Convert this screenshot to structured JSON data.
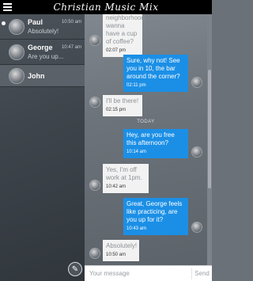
{
  "app": {
    "title": "Christian Music Mix"
  },
  "contacts": [
    {
      "name": "Paul",
      "preview": "Absolutely!",
      "time": "10:50 am",
      "online": true,
      "active": false
    },
    {
      "name": "George",
      "preview": "Are you up...",
      "time": "10:47 am",
      "online": false,
      "active": false
    },
    {
      "name": "John",
      "preview": "",
      "time": "",
      "online": false,
      "active": true
    }
  ],
  "conversation": {
    "today_label": "TODAY",
    "messages": [
      {
        "dir": "in",
        "text": "neighborhood, wanna have a cup of coffee?",
        "time": "02:07 pm"
      },
      {
        "dir": "out",
        "text": "Sure, why not! See you in 10, the bar around the corner?",
        "time": "02:11 pm"
      },
      {
        "dir": "in",
        "text": "I'll be there!",
        "time": "02:15 pm"
      },
      {
        "dir": "out",
        "text": "Hey, are you free this afternoon?",
        "time": "10:14 am"
      },
      {
        "dir": "in",
        "text": "Yes, I'm off work at 1pm.",
        "time": "10:42 am"
      },
      {
        "dir": "out",
        "text": "Great, George feels like practicing, are you up for it?",
        "time": "10:43 am"
      },
      {
        "dir": "in",
        "text": "Absolutely!",
        "time": "10:50 am"
      }
    ]
  },
  "input": {
    "placeholder": "Your message",
    "send_label": "Send"
  },
  "icons": {
    "menu": "hamburger-icon",
    "compose": "pencil-icon"
  },
  "colors": {
    "outgoing_bubble": "#1b8fe6",
    "incoming_bubble": "#f2f2f2",
    "titlebar": "#000000"
  }
}
